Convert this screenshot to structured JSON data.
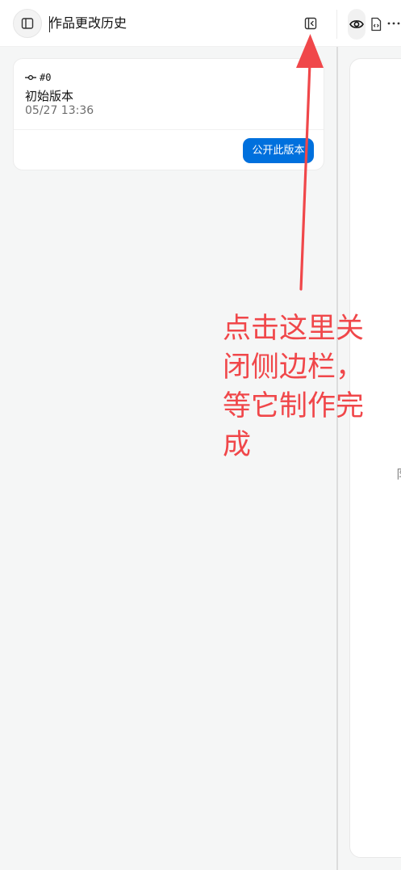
{
  "header": {
    "title": "作品更改历史"
  },
  "versions": [
    {
      "commit": "#0",
      "name": "初始版本",
      "time": "05/27 13:36",
      "publish_label": "公开此版本"
    }
  ],
  "main": {
    "partial_text": "阝"
  },
  "annotation": {
    "text": "点击这里关闭侧边栏，等它制作完成",
    "color": "#f0474a"
  },
  "icons": {
    "sidebar_toggle": "sidebar-panel-icon",
    "collapse": "collapse-sidebar-icon",
    "preview": "eye-icon",
    "code": "code-file-icon",
    "more": "more-icon",
    "commit": "commit-icon"
  },
  "colors": {
    "accent": "#0070dd",
    "annotation": "#f0474a"
  }
}
